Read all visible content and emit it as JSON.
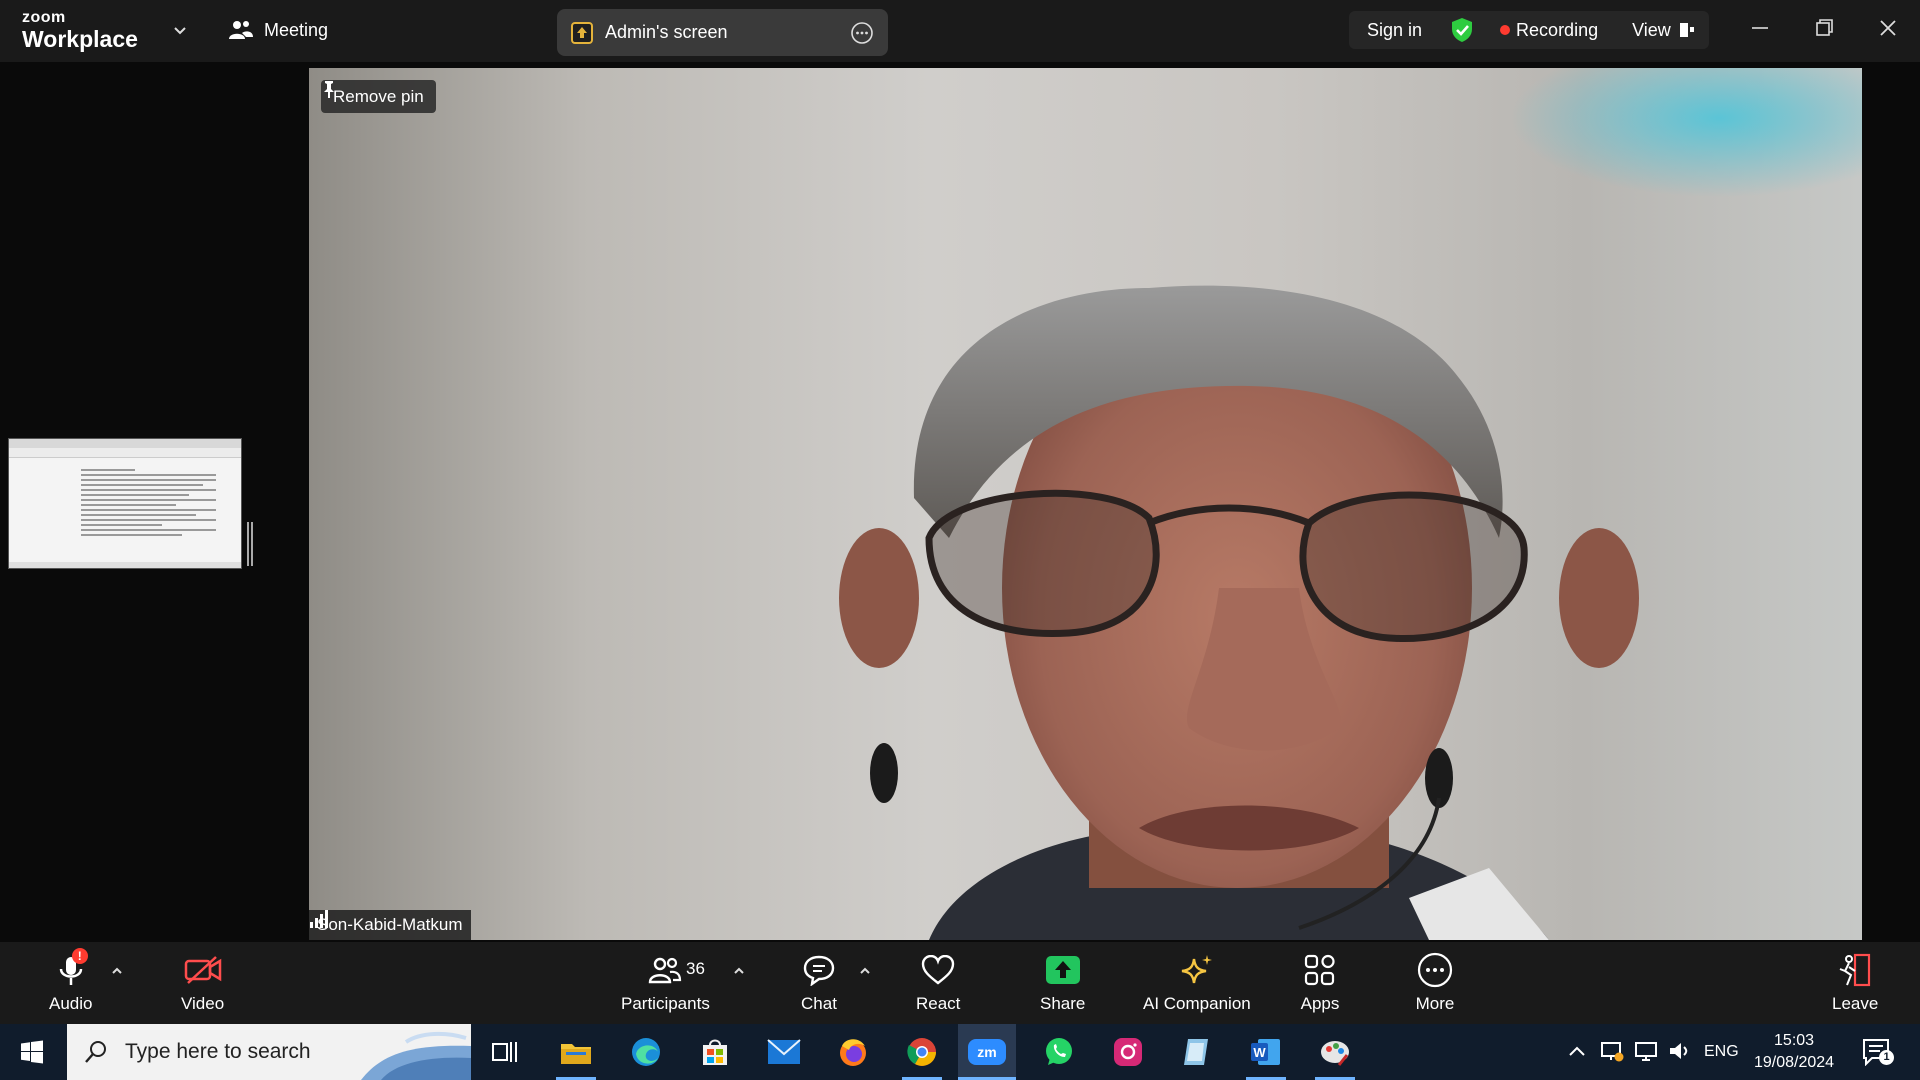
{
  "titlebar": {
    "brand_top": "zoom",
    "brand_bottom": "Workplace",
    "meeting_label": "Meeting",
    "screen_share_label": "Admin's screen",
    "sign_in": "Sign in",
    "recording": "Recording",
    "view": "View"
  },
  "stage": {
    "remove_pin": "Remove pin",
    "speaker_name": "Son-Kabid-Matkum"
  },
  "toolbar": {
    "audio": "Audio",
    "video": "Video",
    "participants": "Participants",
    "participants_count": "36",
    "chat": "Chat",
    "react": "React",
    "share": "Share",
    "ai_companion": "AI Companion",
    "apps": "Apps",
    "more": "More",
    "leave": "Leave"
  },
  "taskbar": {
    "search_placeholder": "Type here to search",
    "language": "ENG",
    "time": "15:03",
    "date": "19/08/2024",
    "notification_count": "1"
  },
  "colors": {
    "recording_dot": "#ff3b30",
    "shield_green": "#2ecc40",
    "share_green": "#22c55e",
    "ai_star": "#f5c542",
    "video_off_red": "#ff4d4d"
  }
}
